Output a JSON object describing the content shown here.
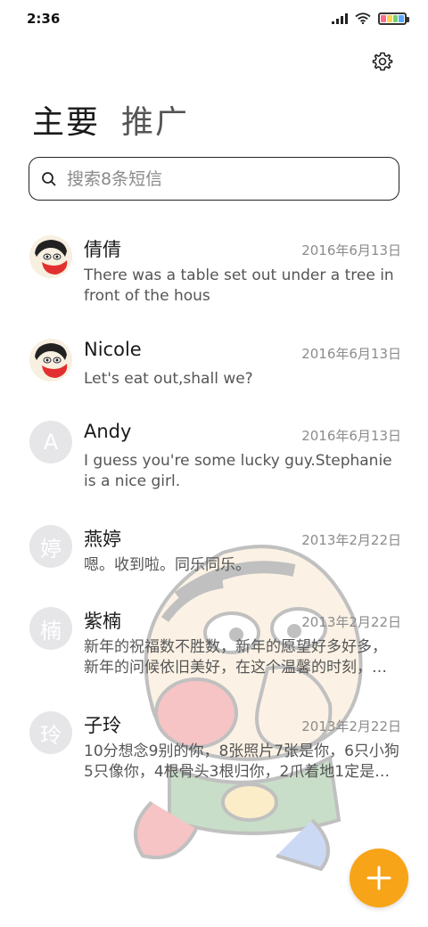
{
  "status_bar": {
    "time": "2:36",
    "icons": [
      "signal-icon",
      "wifi-icon",
      "battery-icon"
    ]
  },
  "header": {
    "settings_icon": "gear-icon",
    "tabs": [
      {
        "label": "主要",
        "active": true
      },
      {
        "label": "推广",
        "active": false
      }
    ]
  },
  "search": {
    "placeholder": "搜索8条短信",
    "value": ""
  },
  "messages": [
    {
      "name": "倩倩",
      "date": "2016年6月13日",
      "preview": "There was a table set out under a tree in front of the hous",
      "avatar_type": "photo",
      "avatar_letter": ""
    },
    {
      "name": "Nicole",
      "date": "2016年6月13日",
      "preview": "Let's eat out,shall we?",
      "avatar_type": "photo",
      "avatar_letter": ""
    },
    {
      "name": "Andy",
      "date": "2016年6月13日",
      "preview": "I guess you're some lucky guy.Stephanie is a nice girl.",
      "avatar_type": "letter",
      "avatar_letter": "A"
    },
    {
      "name": "燕婷",
      "date": "2013年2月22日",
      "preview": "嗯。收到啦。同乐同乐。",
      "avatar_type": "letter",
      "avatar_letter": "婷"
    },
    {
      "name": "紫楠",
      "date": "2013年2月22日",
      "preview": "新年的祝福数不胜数，新年的愿望好多好多，新年的问候依旧美好，在这个温馨的时刻，…",
      "avatar_type": "letter",
      "avatar_letter": "楠"
    },
    {
      "name": "子玲",
      "date": "2013年2月22日",
      "preview": "10分想念9别的你，8张照片7张是你，6只小狗5只像你，4根骨头3根归你，2爪着地1定是…",
      "avatar_type": "letter",
      "avatar_letter": "玲"
    }
  ],
  "fab": {
    "icon": "plus-icon"
  },
  "colors": {
    "accent": "#f7a418",
    "avatar_bg": "#e6e6e8",
    "date_text": "#8c8c8c",
    "preview_text": "#555555"
  }
}
